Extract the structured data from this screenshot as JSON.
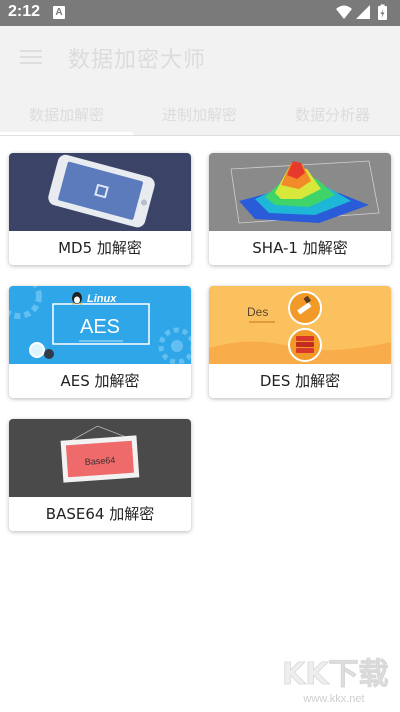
{
  "status_bar": {
    "time": "2:12",
    "notification_glyph": "A"
  },
  "app_bar": {
    "title": "数据加密大师",
    "menu_icon": "hamburger-menu-icon"
  },
  "tabs": [
    {
      "label": "数据加解密",
      "selected": true
    },
    {
      "label": "进制加解密",
      "selected": false
    },
    {
      "label": "数据分析器",
      "selected": false
    }
  ],
  "cards": [
    {
      "label": "MD5 加解密",
      "image": "phone-illustration"
    },
    {
      "label": "SHA-1 加解密",
      "image": "3d-surface-plot"
    },
    {
      "label": "AES 加解密",
      "image": "linux-aes-banner",
      "banner_title": "Linux",
      "banner_text": "AES"
    },
    {
      "label": "DES 加解密",
      "image": "des-banner",
      "banner_text": "Des"
    },
    {
      "label": "BASE64 加解密",
      "image": "base64-frame",
      "banner_text": "Base64"
    }
  ],
  "watermark": {
    "logo_text": "KK下载",
    "url": "www.kkx.net"
  },
  "colors": {
    "status_bar": "#7a7a7a",
    "app_bar": "#f2f2f2",
    "md5_bg": "#3b4466",
    "sha_bg": "#8a8a8a",
    "aes_bg": "#2ea6e8",
    "des_bg": "#fbc15e",
    "base64_bg": "#4a4a4a"
  }
}
